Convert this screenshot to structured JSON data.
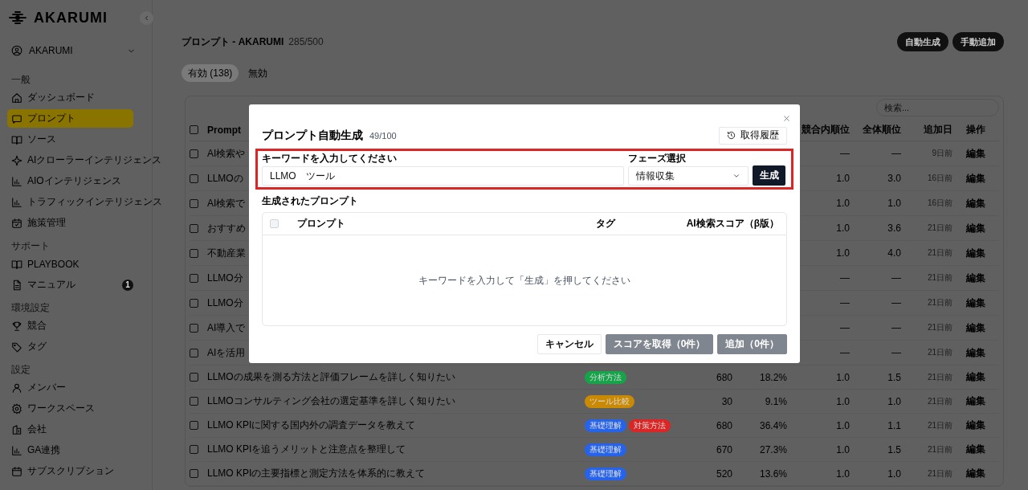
{
  "sidebar": {
    "brand": "AKARUMI",
    "account": "AKARUMI",
    "sections": [
      {
        "title": "一般",
        "items": [
          {
            "label": "ダッシュボード",
            "selected": false
          },
          {
            "label": "プロンプト",
            "selected": true
          },
          {
            "label": "ソース",
            "selected": false
          },
          {
            "label": "AIクローラーインテリジェンス",
            "selected": false
          },
          {
            "label": "AIOインテリジェンス",
            "selected": false
          },
          {
            "label": "トラフィックインテリジェンス",
            "selected": false
          },
          {
            "label": "施策管理",
            "selected": false
          }
        ]
      },
      {
        "title": "サポート",
        "items": [
          {
            "label": "PLAYBOOK",
            "selected": false
          },
          {
            "label": "マニュアル",
            "selected": false,
            "badge": "1"
          }
        ]
      },
      {
        "title": "環境設定",
        "items": [
          {
            "label": "競合",
            "selected": false
          },
          {
            "label": "タグ",
            "selected": false
          }
        ]
      },
      {
        "title": "設定",
        "items": [
          {
            "label": "メンバー",
            "selected": false
          },
          {
            "label": "ワークスペース",
            "selected": false
          },
          {
            "label": "会社",
            "selected": false
          },
          {
            "label": "GA連携",
            "selected": false
          },
          {
            "label": "サブスクリプション",
            "selected": false
          }
        ]
      }
    ]
  },
  "header": {
    "title": "プロンプト - AKARUMI",
    "count": "285/500",
    "buttons": [
      "自動生成",
      "手動追加"
    ]
  },
  "tabs": [
    {
      "label": "有効 (138)",
      "selected": true
    },
    {
      "label": "無効",
      "selected": false
    }
  ],
  "table": {
    "search_placeholder": "検索...",
    "select_all_checked": false,
    "columns": {
      "prompt": "Prompt",
      "competitor_rank": "競合内順位",
      "overall_rank": "全体順位",
      "added": "追加日",
      "action": "操作"
    },
    "rows": [
      {
        "checked": false,
        "prompt": "AI検索や",
        "competitor_rank": "—",
        "overall_rank": "—",
        "added": "9日前",
        "action": "編集"
      },
      {
        "checked": false,
        "prompt": "LLMOの",
        "competitor_rank": "1.0",
        "overall_rank": "3.0",
        "added": "16日前",
        "action": "編集"
      },
      {
        "checked": false,
        "prompt": "AI検索で",
        "competitor_rank": "1.0",
        "overall_rank": "1.0",
        "added": "16日前",
        "action": "編集"
      },
      {
        "checked": false,
        "prompt": "おすすめ",
        "competitor_rank": "1.0",
        "overall_rank": "3.6",
        "added": "21日前",
        "action": "編集"
      },
      {
        "checked": false,
        "prompt": "不動産業",
        "competitor_rank": "1.0",
        "overall_rank": "4.0",
        "added": "21日前",
        "action": "編集"
      },
      {
        "checked": false,
        "prompt": "LLMO分",
        "competitor_rank": "—",
        "overall_rank": "—",
        "added": "21日前",
        "action": "編集"
      },
      {
        "checked": false,
        "prompt": "LLMO分",
        "competitor_rank": "—",
        "overall_rank": "—",
        "added": "21日前",
        "action": "編集"
      },
      {
        "checked": false,
        "prompt": "AI導入で",
        "competitor_rank": "—",
        "overall_rank": "—",
        "added": "21日前",
        "action": "編集"
      },
      {
        "checked": false,
        "prompt": "AIを活用",
        "competitor_rank": "—",
        "overall_rank": "—",
        "added": "21日前",
        "action": "編集"
      },
      {
        "checked": false,
        "prompt": "LLMOの成果を測る方法と評価フレームを詳しく知りたい",
        "tags": [
          {
            "label": "分析方法",
            "color": "#16a34a"
          }
        ],
        "column_a": "680",
        "column_b": "18.2%",
        "competitor_rank": "1.0",
        "overall_rank": "1.5",
        "added": "21日前",
        "action": "編集"
      },
      {
        "checked": false,
        "prompt": "LLMOコンサルティング会社の選定基準を詳しく知りたい",
        "tags": [
          {
            "label": "ツール比較",
            "color": "#ca8a04"
          }
        ],
        "column_a": "30",
        "column_b": "9.1%",
        "competitor_rank": "1.0",
        "overall_rank": "1.0",
        "added": "21日前",
        "action": "編集"
      },
      {
        "checked": false,
        "prompt": "LLMO KPIに関する国内外の調査データを教えて",
        "tags": [
          {
            "label": "基礎理解",
            "color": "#2563eb"
          },
          {
            "label": "対策方法",
            "color": "#dc2626"
          }
        ],
        "column_a": "680",
        "column_b": "36.4%",
        "competitor_rank": "1.0",
        "overall_rank": "1.1",
        "added": "21日前",
        "action": "編集"
      },
      {
        "checked": false,
        "prompt": "LLMO KPIを追うメリットと注意点を整理して",
        "tags": [
          {
            "label": "基礎理解",
            "color": "#2563eb"
          }
        ],
        "column_a": "670",
        "column_b": "27.3%",
        "competitor_rank": "1.0",
        "overall_rank": "1.5",
        "added": "21日前",
        "action": "編集"
      },
      {
        "checked": false,
        "prompt": "LLMO KPIの主要指標と測定方法を体系的に教えて",
        "tags": [
          {
            "label": "基礎理解",
            "color": "#2563eb"
          }
        ],
        "column_a": "520",
        "column_b": "13.6%",
        "competitor_rank": "1.0",
        "overall_rank": "1.0",
        "added": "21日前",
        "action": "編集"
      }
    ]
  },
  "modal": {
    "title": "プロンプト自動生成",
    "count": "49/100",
    "history_button": "取得履歴",
    "keyword_label": "キーワードを入力してください",
    "keyword_value": "LLMO　ツール",
    "phase_label": "フェーズ選択",
    "phase_value": "情報収集",
    "generate_button": "生成",
    "section_title": "生成されたプロンプト",
    "table": {
      "select_all_checked": false,
      "columns": [
        "プロンプト",
        "タグ",
        "AI検索スコア（β版）"
      ],
      "empty_message": "キーワードを入力して「生成」を押してください"
    },
    "buttons": [
      {
        "label": "キャンセル",
        "kind": "outline",
        "disabled": false
      },
      {
        "label": "スコアを取得（0件）",
        "kind": "primary",
        "disabled": true
      },
      {
        "label": "追加（0件）",
        "kind": "primary",
        "disabled": true
      }
    ]
  }
}
